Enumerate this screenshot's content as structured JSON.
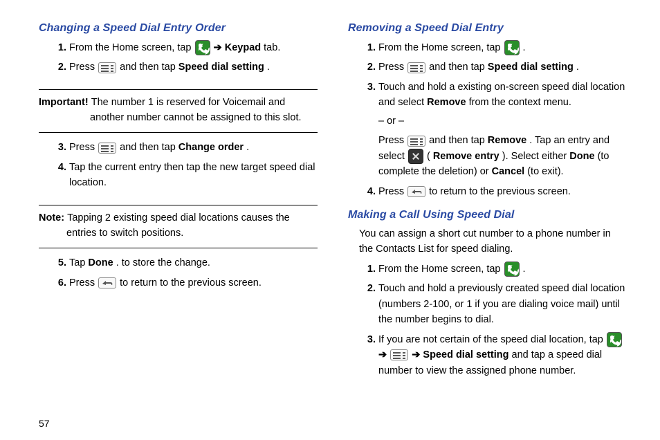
{
  "left": {
    "heading1": "Changing a Speed Dial Entry Order",
    "s1": {
      "n1": "1.",
      "t1a": "From the Home screen, tap ",
      "t1b": " ➔ ",
      "t1c": "Keypad",
      "t1d": " tab.",
      "n2": "2.",
      "t2a": "Press ",
      "t2b": " and then tap ",
      "t2c": "Speed dial setting",
      "t2d": "."
    },
    "important": {
      "label": "Important! ",
      "text": "The number 1 is reserved for Voicemail and another number cannot be assigned to this slot."
    },
    "s2": {
      "n3": "3.",
      "t3a": "Press ",
      "t3b": " and then tap ",
      "t3c": "Change order",
      "t3d": ".",
      "n4": "4.",
      "t4": "Tap the current entry then tap the new target speed dial location."
    },
    "note": {
      "label": "Note: ",
      "text": "Tapping 2 existing speed dial locations causes the entries to switch positions."
    },
    "s3": {
      "n5": "5.",
      "t5a": "Tap ",
      "t5b": "Done",
      "t5c": ". to store the change.",
      "n6": "6.",
      "t6a": "Press ",
      "t6b": " to return to the previous screen."
    }
  },
  "right": {
    "heading1": "Removing a Speed Dial Entry",
    "r1": {
      "n1": "1.",
      "t1a": "From the Home screen, tap ",
      "t1b": ".",
      "n2": "2.",
      "t2a": "Press ",
      "t2b": " and then tap ",
      "t2c": "Speed dial setting",
      "t2d": ".",
      "n3": "3.",
      "t3a": "Touch and hold a existing on-screen speed dial location and select ",
      "t3b": "Remove",
      "t3c": " from the context menu.",
      "ordash": "– or –",
      "t3d": "Press ",
      "t3e": " and then tap ",
      "t3f": "Remove",
      "t3g": ". Tap an entry and select ",
      "t3h": " (",
      "t3i": "Remove entry",
      "t3j": "). Select either ",
      "t3k": "Done",
      "t3l": " (to complete the deletion) or ",
      "t3m": "Cancel",
      "t3n": " (to exit).",
      "n4": "4.",
      "t4a": "Press ",
      "t4b": " to return to the previous screen."
    },
    "heading2": "Making a Call Using Speed Dial",
    "intro": "You can assign a short cut number to a phone number in the Contacts List for speed dialing.",
    "r2": {
      "n1": "1.",
      "t1a": "From the Home screen, tap ",
      "t1b": ".",
      "n2": "2.",
      "t2": "Touch and hold a previously created speed dial location (numbers 2-100, or 1 if you are dialing voice mail) until the number begins to dial.",
      "n3": "3.",
      "t3a": "If you are not certain of the speed dial location, tap ",
      "t3b": " ➔ ",
      "t3c": " ➔ ",
      "t3d": "Speed dial setting",
      "t3e": " and tap a speed dial number to view the assigned phone number."
    }
  },
  "pagenum": "57"
}
